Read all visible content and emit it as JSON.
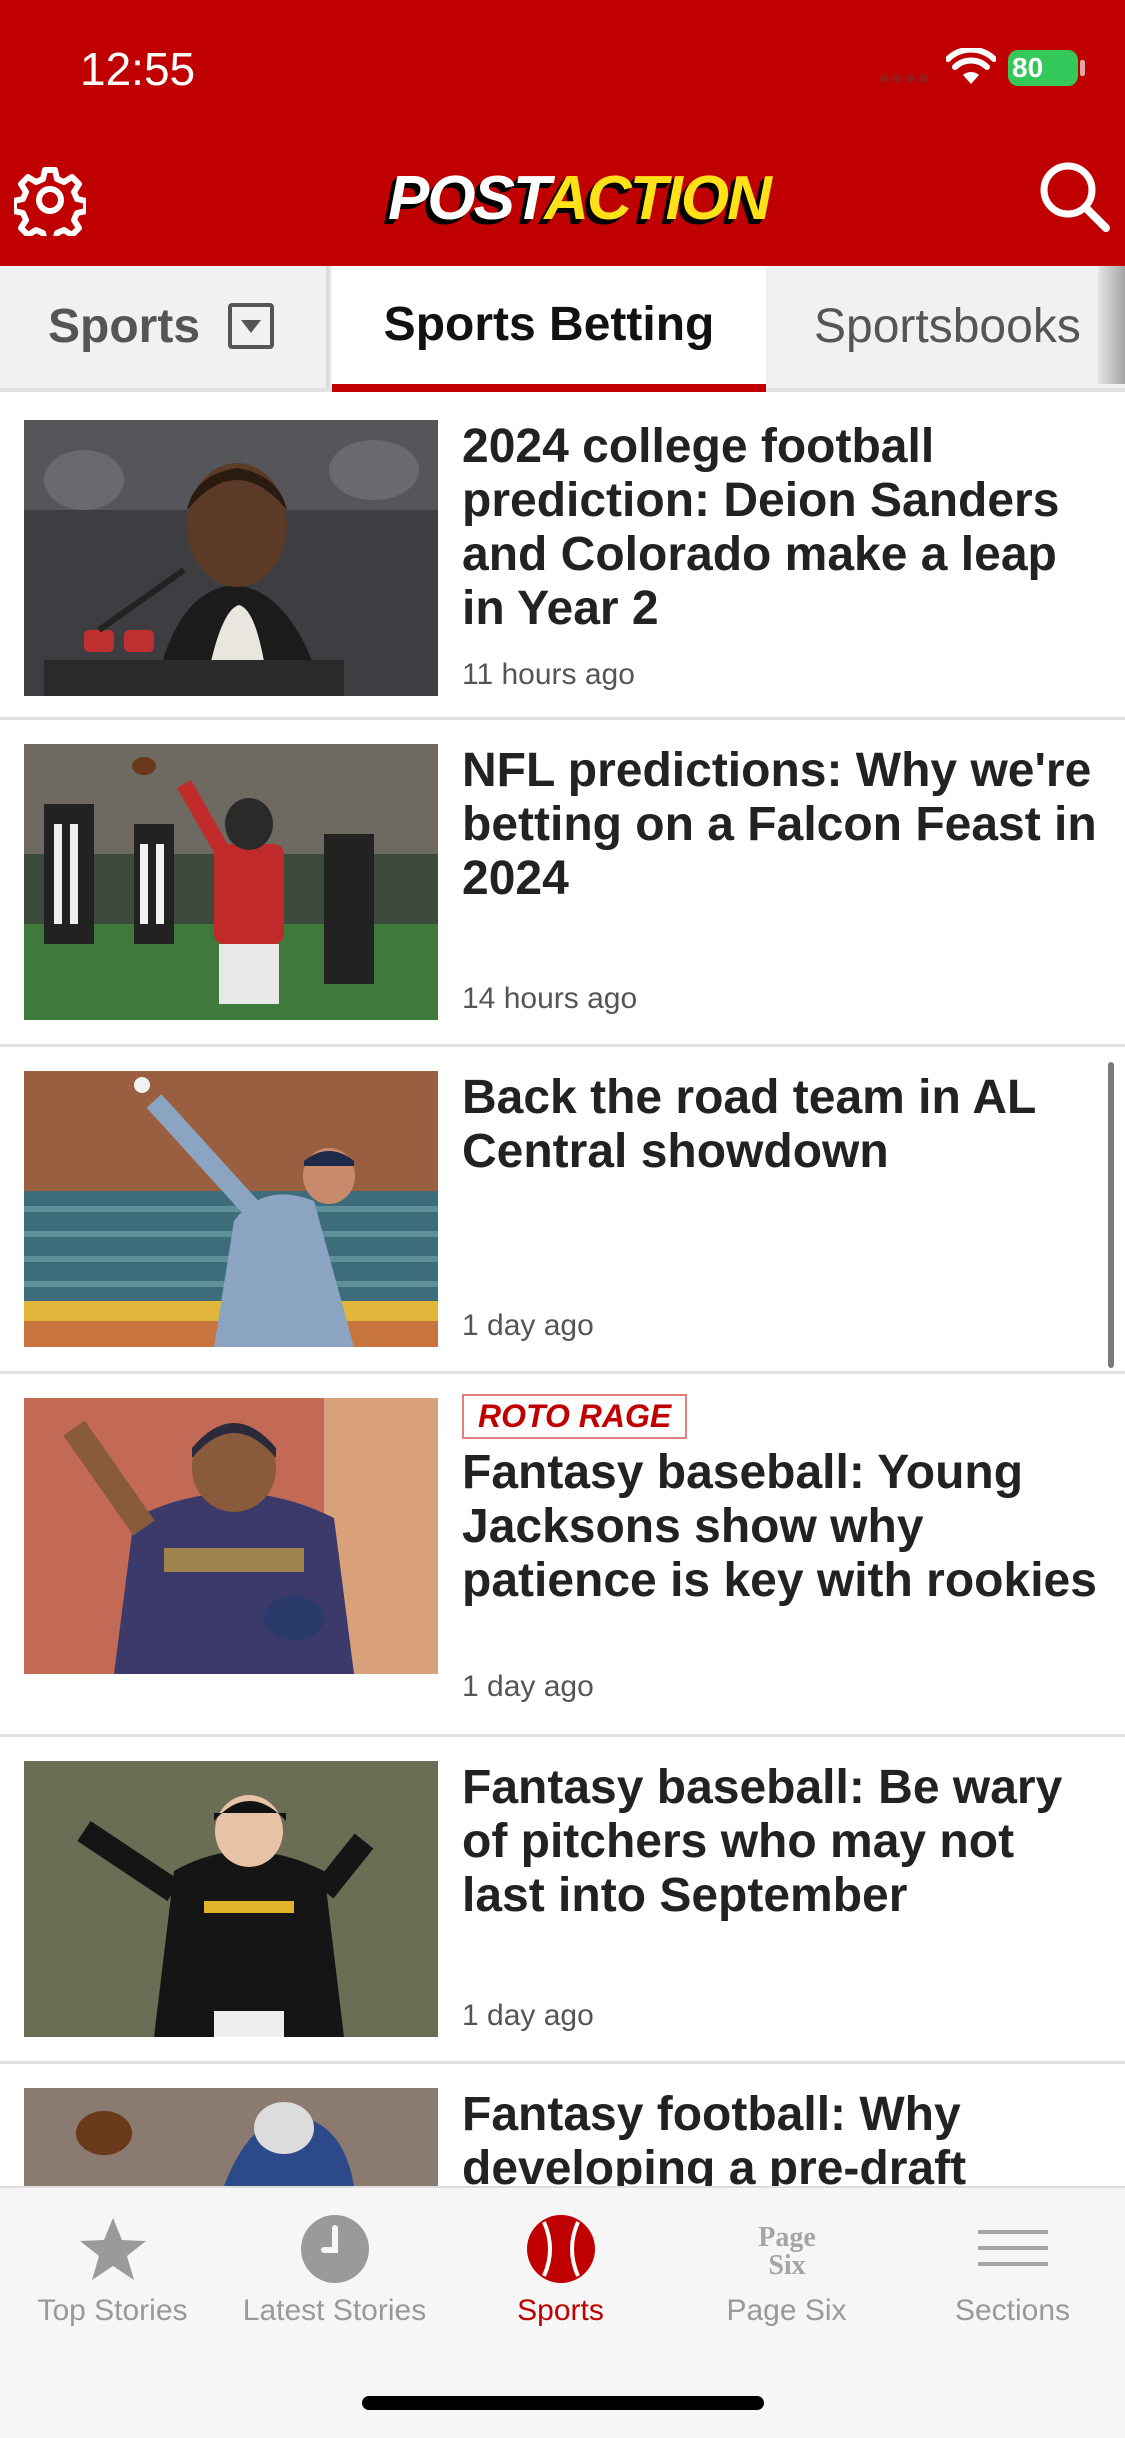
{
  "status_bar": {
    "time": "12:55",
    "battery": "80"
  },
  "header": {
    "logo_part1": "POST",
    "logo_part2": "ACTION",
    "settings_icon": "gear-icon",
    "search_icon": "search-icon"
  },
  "tabs": [
    {
      "label": "Sports",
      "has_dropdown": true
    },
    {
      "label": "Sports Betting",
      "active": true
    },
    {
      "label": "Sportsbooks"
    }
  ],
  "articles": [
    {
      "headline": "2024 college football prediction: Deion Sanders and Colorado make a leap in Year 2",
      "time": "11 hours ago"
    },
    {
      "headline": "NFL predictions: Why we're betting on a Falcon Feast in 2024",
      "time": "14 hours ago"
    },
    {
      "headline": "Back the road team in AL Central showdown",
      "time": "1 day ago"
    },
    {
      "kicker": "ROTO RAGE",
      "headline": "Fantasy baseball: Young Jacksons show why patience is key with rookies",
      "time": "1 day ago"
    },
    {
      "headline": "Fantasy baseball: Be wary of pitchers who may not last into September",
      "time": "1 day ago"
    },
    {
      "headline": "Fantasy football: Why developing a pre-draft"
    }
  ],
  "bottom_nav": [
    {
      "label": "Top Stories",
      "icon": "star-icon"
    },
    {
      "label": "Latest Stories",
      "icon": "clock-icon"
    },
    {
      "label": "Sports",
      "icon": "baseball-icon",
      "active": true
    },
    {
      "label": "Page Six",
      "icon": "page-six-icon",
      "icon_text_1": "Page",
      "icon_text_2": "Six"
    },
    {
      "label": "Sections",
      "icon": "menu-icon"
    }
  ],
  "colors": {
    "brand_red": "#c00000",
    "logo_yellow": "#ffe11a"
  }
}
